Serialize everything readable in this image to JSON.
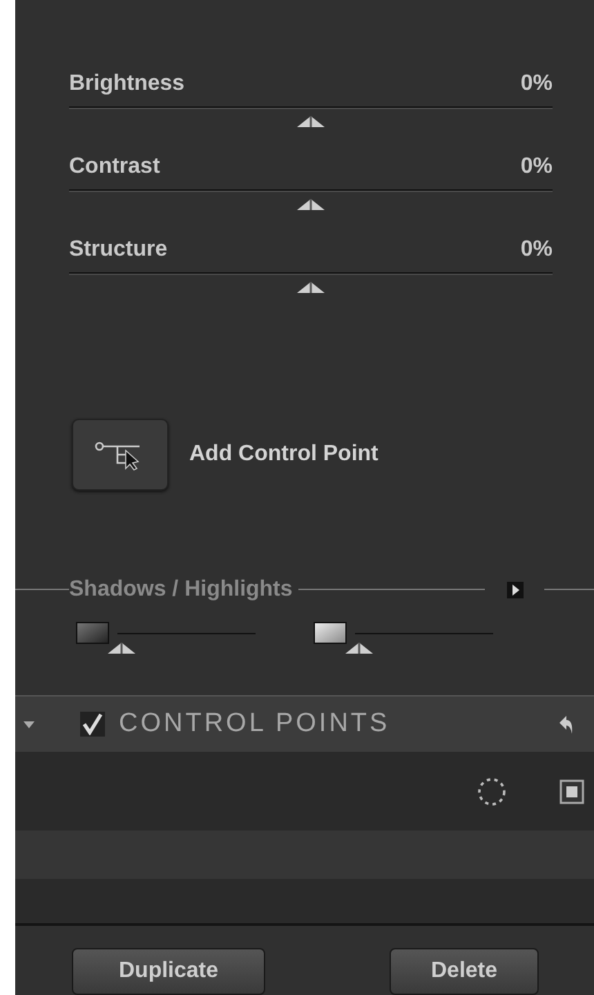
{
  "sliders": [
    {
      "label": "Brightness",
      "value": "0%",
      "level": 0.5
    },
    {
      "label": "Contrast",
      "value": "0%",
      "level": 0.5
    },
    {
      "label": "Structure",
      "value": "0%",
      "level": 0.5
    }
  ],
  "add_control_point": {
    "label": "Add Control Point"
  },
  "shadows_highlights": {
    "title": "Shadows / Highlights",
    "expanded": false,
    "sliders": [
      {
        "kind": "shadow",
        "level": 0.03
      },
      {
        "kind": "highlight",
        "level": 0.03
      }
    ]
  },
  "control_points": {
    "title": "CONTROL POINTS",
    "checked": true,
    "expanded": true
  },
  "buttons": [
    "Duplicate",
    "Delete"
  ]
}
